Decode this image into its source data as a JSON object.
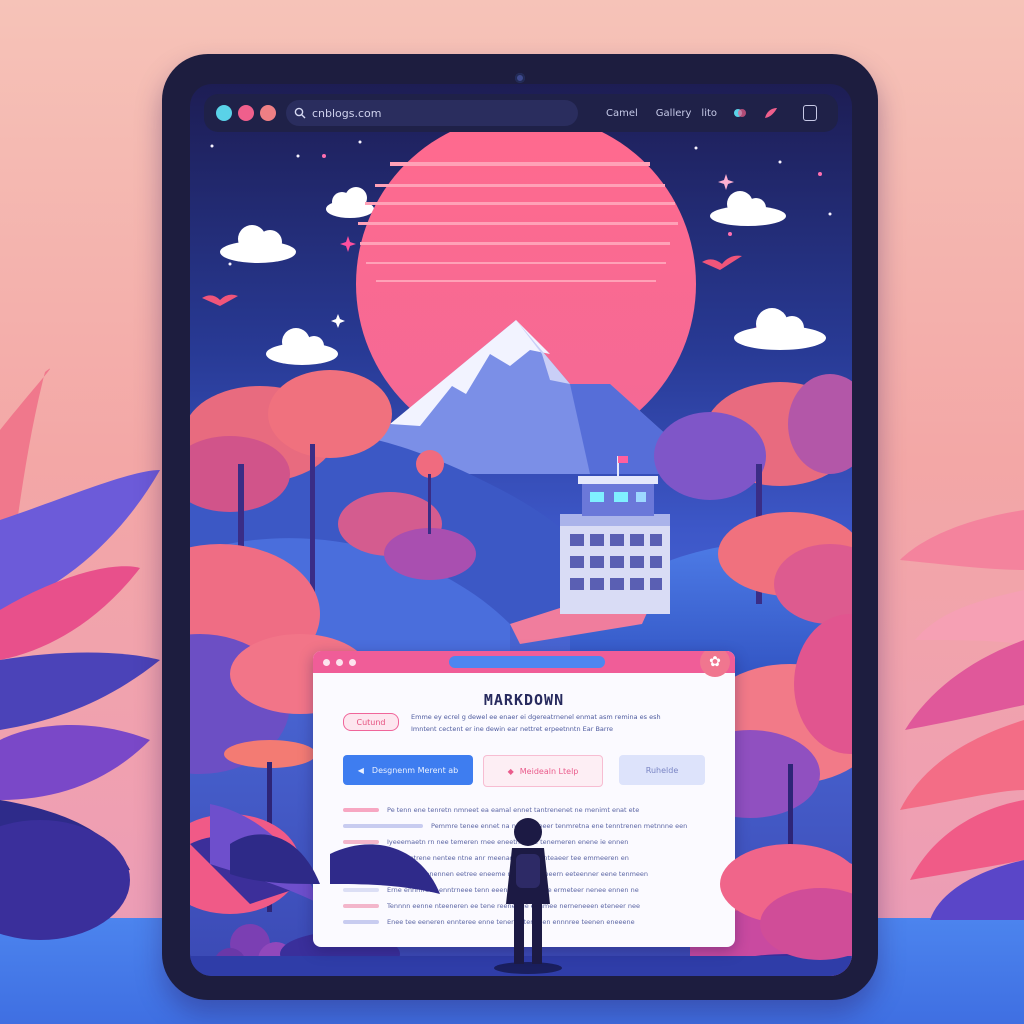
{
  "browser": {
    "url": "cnblogs.com",
    "nav": [
      "Camel",
      "Gallery",
      "lito"
    ],
    "icons": {
      "traffic_lights": [
        "#5ad2e8",
        "#ef5f8c",
        "#ee7f84"
      ],
      "search": "search-icon",
      "brand": "brand-icon",
      "feather": "feather-icon",
      "menu": "menu-icon"
    }
  },
  "markdown_window": {
    "title": "MARKDOWN",
    "tag": "Cutund",
    "intro": [
      "Emme ey ecrel g dewel ee enaer ei dgereatrnenel enmat asm remina es esh",
      "Imntent cectent er ine dewin ear nettret erpeetnntn Ear Barre"
    ],
    "buttons": [
      "Desgnenm Merent ab",
      "Meidealn Ltelp",
      "Ruhelde"
    ],
    "lines": [
      "Pe tenn ene tenretn nmneet ea eamal ennet tantrenenet ne menimt enat ete",
      "Pemmre tenee ennet na neennti eeer tenmretna ene tenntrenen metnnne een",
      "Iyeeemaetn rn nee temeren rnee eneetne ene tenemeren enene ie ennen",
      "Ene enntrene nentee ntne anr meenanretn nee nteaeer tee emmeeren en",
      "Eneeen enennen eetree eneeme nnemeen eneern eeteenner eene tenmeen",
      "Erne ennmreee enntrneee tenn eeenren nerne ree ermeteer nenee ennen ne",
      "Tennnn eenne nteeneren ee tene reenerree eenmee nerneneeen eteneer nee",
      "Enee tee eeneren ennteree enne teneree teneeen ennnree teenen eneeene"
    ]
  },
  "colors": {
    "wallpaper": "#f3a7a6",
    "floor": "#4c84ee",
    "tablet_frame": "#1d1d3f",
    "accent_pink": "#f05d98",
    "accent_blue": "#3e7df0",
    "sun": "#fb6a8f"
  }
}
